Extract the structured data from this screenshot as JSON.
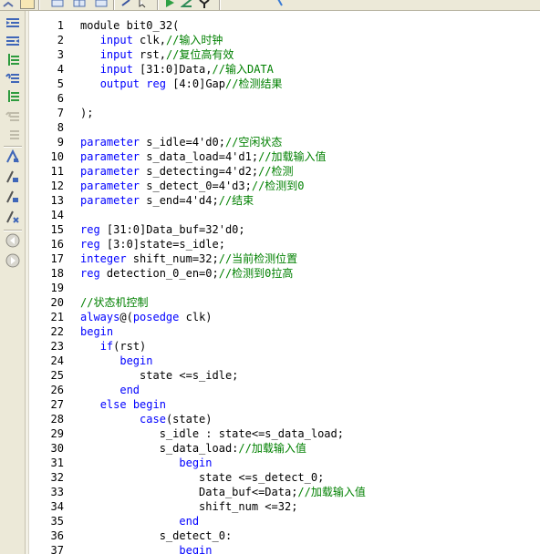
{
  "colors": {
    "keyword": "#0000ff",
    "comment": "#008000",
    "text": "#000000",
    "toolbar_bg": "#ece9d8"
  },
  "toolbar": {
    "icons": [
      "undo-icon",
      "copy-window-icon",
      "split-horizontal-icon",
      "split-vertical-icon",
      "bookmark-tool-icon",
      "find-icon",
      "run-icon",
      "compile-icon",
      "simulate-icon",
      "help-icon"
    ]
  },
  "side_toolbar": {
    "icons": [
      "indent-left-icon",
      "indent-right-icon",
      "comment-icon",
      "uncomment-icon",
      "undo-comment-icon",
      "toggle-bookmark-icon",
      "next-bookmark-icon",
      "prev-bookmark-icon",
      "clear-bookmarks-icon",
      "back-icon",
      "forward-icon"
    ]
  },
  "code_lines": [
    {
      "num": "1",
      "segments": [
        {
          "t": "module bit0_32(",
          "c": "kw-first"
        }
      ]
    },
    {
      "num": "2",
      "segments": [
        {
          "t": "   ",
          "c": ""
        },
        {
          "t": "input",
          "c": "kw"
        },
        {
          "t": " clk,",
          "c": ""
        },
        {
          "t": "//输入时钟",
          "c": "cm"
        }
      ]
    },
    {
      "num": "3",
      "segments": [
        {
          "t": "   ",
          "c": ""
        },
        {
          "t": "input",
          "c": "kw"
        },
        {
          "t": " rst,",
          "c": ""
        },
        {
          "t": "//复位高有效",
          "c": "cm"
        }
      ]
    },
    {
      "num": "4",
      "segments": [
        {
          "t": "   ",
          "c": ""
        },
        {
          "t": "input",
          "c": "kw"
        },
        {
          "t": " [31:0]Data,",
          "c": ""
        },
        {
          "t": "//输入DATA",
          "c": "cm"
        }
      ]
    },
    {
      "num": "5",
      "segments": [
        {
          "t": "   ",
          "c": ""
        },
        {
          "t": "output",
          "c": "kw"
        },
        {
          "t": " ",
          "c": ""
        },
        {
          "t": "reg",
          "c": "kw"
        },
        {
          "t": " [4:0]Gap",
          "c": ""
        },
        {
          "t": "//检测结果",
          "c": "cm"
        }
      ]
    },
    {
      "num": "6",
      "segments": []
    },
    {
      "num": "7",
      "segments": [
        {
          "t": ");",
          "c": ""
        }
      ]
    },
    {
      "num": "8",
      "segments": []
    },
    {
      "num": "9",
      "segments": [
        {
          "t": "parameter",
          "c": "kw"
        },
        {
          "t": " s_idle=4'd0;",
          "c": ""
        },
        {
          "t": "//空闲状态",
          "c": "cm"
        }
      ]
    },
    {
      "num": "10",
      "segments": [
        {
          "t": "parameter",
          "c": "kw"
        },
        {
          "t": " s_data_load=4'd1;",
          "c": ""
        },
        {
          "t": "//加载输入值",
          "c": "cm"
        }
      ]
    },
    {
      "num": "11",
      "segments": [
        {
          "t": "parameter",
          "c": "kw"
        },
        {
          "t": " s_detecting=4'd2;",
          "c": ""
        },
        {
          "t": "//检测",
          "c": "cm"
        }
      ]
    },
    {
      "num": "12",
      "segments": [
        {
          "t": "parameter",
          "c": "kw"
        },
        {
          "t": " s_detect_0=4'd3;",
          "c": ""
        },
        {
          "t": "//检测到0",
          "c": "cm"
        }
      ]
    },
    {
      "num": "13",
      "segments": [
        {
          "t": "parameter",
          "c": "kw"
        },
        {
          "t": " s_end=4'd4;",
          "c": ""
        },
        {
          "t": "//结束",
          "c": "cm"
        }
      ]
    },
    {
      "num": "14",
      "segments": []
    },
    {
      "num": "15",
      "segments": [
        {
          "t": "reg",
          "c": "kw"
        },
        {
          "t": " [31:0]Data_buf=32'd0;",
          "c": ""
        }
      ]
    },
    {
      "num": "16",
      "segments": [
        {
          "t": "reg",
          "c": "kw"
        },
        {
          "t": " [3:0]state=s_idle;",
          "c": ""
        }
      ]
    },
    {
      "num": "17",
      "segments": [
        {
          "t": "integer",
          "c": "kw"
        },
        {
          "t": " shift_num=32;",
          "c": ""
        },
        {
          "t": "//当前检测位置",
          "c": "cm"
        }
      ]
    },
    {
      "num": "18",
      "segments": [
        {
          "t": "reg",
          "c": "kw"
        },
        {
          "t": " detection_0_en=0;",
          "c": ""
        },
        {
          "t": "//检测到0拉高",
          "c": "cm"
        }
      ]
    },
    {
      "num": "19",
      "segments": []
    },
    {
      "num": "20",
      "segments": [
        {
          "t": "//状态机控制",
          "c": "cm"
        }
      ]
    },
    {
      "num": "21",
      "segments": [
        {
          "t": "always",
          "c": "kw"
        },
        {
          "t": "@(",
          "c": ""
        },
        {
          "t": "posedge",
          "c": "kw"
        },
        {
          "t": " clk)",
          "c": ""
        }
      ]
    },
    {
      "num": "22",
      "segments": [
        {
          "t": "begin",
          "c": "kw"
        }
      ]
    },
    {
      "num": "23",
      "segments": [
        {
          "t": "   ",
          "c": ""
        },
        {
          "t": "if",
          "c": "kw"
        },
        {
          "t": "(rst)",
          "c": ""
        }
      ]
    },
    {
      "num": "24",
      "segments": [
        {
          "t": "      ",
          "c": ""
        },
        {
          "t": "begin",
          "c": "kw"
        }
      ]
    },
    {
      "num": "25",
      "segments": [
        {
          "t": "         state <=s_idle;",
          "c": ""
        }
      ]
    },
    {
      "num": "26",
      "segments": [
        {
          "t": "      ",
          "c": ""
        },
        {
          "t": "end",
          "c": "kw"
        }
      ]
    },
    {
      "num": "27",
      "segments": [
        {
          "t": "   ",
          "c": ""
        },
        {
          "t": "else",
          "c": "kw"
        },
        {
          "t": " ",
          "c": ""
        },
        {
          "t": "begin",
          "c": "kw"
        }
      ]
    },
    {
      "num": "28",
      "segments": [
        {
          "t": "         ",
          "c": ""
        },
        {
          "t": "case",
          "c": "kw"
        },
        {
          "t": "(state)",
          "c": ""
        }
      ]
    },
    {
      "num": "29",
      "segments": [
        {
          "t": "            s_idle : state<=s_data_load;",
          "c": ""
        }
      ]
    },
    {
      "num": "30",
      "segments": [
        {
          "t": "            s_data_load:",
          "c": ""
        },
        {
          "t": "//加载输入值",
          "c": "cm"
        }
      ]
    },
    {
      "num": "31",
      "segments": [
        {
          "t": "               ",
          "c": ""
        },
        {
          "t": "begin",
          "c": "kw"
        }
      ]
    },
    {
      "num": "32",
      "segments": [
        {
          "t": "                  state <=s_detect_0;",
          "c": ""
        }
      ]
    },
    {
      "num": "33",
      "segments": [
        {
          "t": "                  Data_buf<=Data;",
          "c": ""
        },
        {
          "t": "//加载输入值",
          "c": "cm"
        }
      ]
    },
    {
      "num": "34",
      "segments": [
        {
          "t": "                  shift_num <=32;",
          "c": ""
        }
      ]
    },
    {
      "num": "35",
      "segments": [
        {
          "t": "               ",
          "c": ""
        },
        {
          "t": "end",
          "c": "kw"
        }
      ]
    },
    {
      "num": "36",
      "segments": [
        {
          "t": "            s_detect_0:",
          "c": ""
        }
      ]
    },
    {
      "num": "37",
      "segments": [
        {
          "t": "               ",
          "c": ""
        },
        {
          "t": "begin",
          "c": "kw"
        }
      ]
    }
  ]
}
